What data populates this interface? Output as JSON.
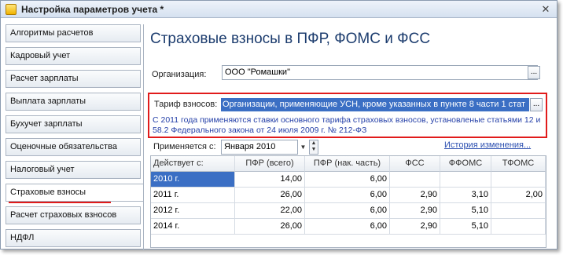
{
  "window": {
    "title": "Настройка параметров учета *"
  },
  "icons": {
    "app": "folder-settings-icon",
    "close": "close-icon",
    "dropdown": "chevron-down-icon",
    "spin": "spin-icon"
  },
  "sidebar": {
    "items": [
      {
        "label": "Алгоритмы расчетов"
      },
      {
        "label": "Кадровый учет"
      },
      {
        "label": "Расчет зарплаты"
      },
      {
        "label": "Выплата зарплаты"
      },
      {
        "label": "Бухучет зарплаты"
      },
      {
        "label": "Оценочные обязательства"
      },
      {
        "label": "Налоговый учет"
      },
      {
        "label": "Страховые взносы",
        "active": true
      },
      {
        "label": "Расчет страховых взносов"
      },
      {
        "label": "НДФЛ"
      }
    ]
  },
  "main": {
    "title": "Страховые взносы в ПФР, ФОМС и ФСС",
    "organization": {
      "label": "Организация:",
      "value": "ООО \"Ромашки\""
    },
    "tariff": {
      "label": "Тариф взносов:",
      "value": "Организации, применяющие УСН, кроме указанных в пункте 8 части 1 стат",
      "note": "С 2011 года применяются ставки основного тарифа страховых взносов, установленые статьями 12 и 58.2 Федерального закона от 24 июля 2009 г. № 212-ФЗ"
    },
    "applies": {
      "label": "Применяется с:",
      "value": "Января  2010"
    },
    "history_link": "История изменения...",
    "ellipsis": "...",
    "table": {
      "columns": [
        "Действует с:",
        "ПФР (всего)",
        "ПФР (нак. часть)",
        "ФСС",
        "ФФОМС",
        "ТФОМС"
      ],
      "rows": [
        [
          "2010 г.",
          "14,00",
          "6,00",
          "",
          "",
          ""
        ],
        [
          "2011 г.",
          "26,00",
          "6,00",
          "2,90",
          "3,10",
          "2,00"
        ],
        [
          "2012 г.",
          "22,00",
          "6,00",
          "2,90",
          "5,10",
          ""
        ],
        [
          "2014 г.",
          "26,00",
          "6,00",
          "2,90",
          "5,10",
          ""
        ]
      ]
    }
  },
  "colors": {
    "highlight_border": "#e11b1b",
    "selection": "#3b6fc4",
    "link": "#2b4fb0",
    "title": "#1c3c6e"
  }
}
